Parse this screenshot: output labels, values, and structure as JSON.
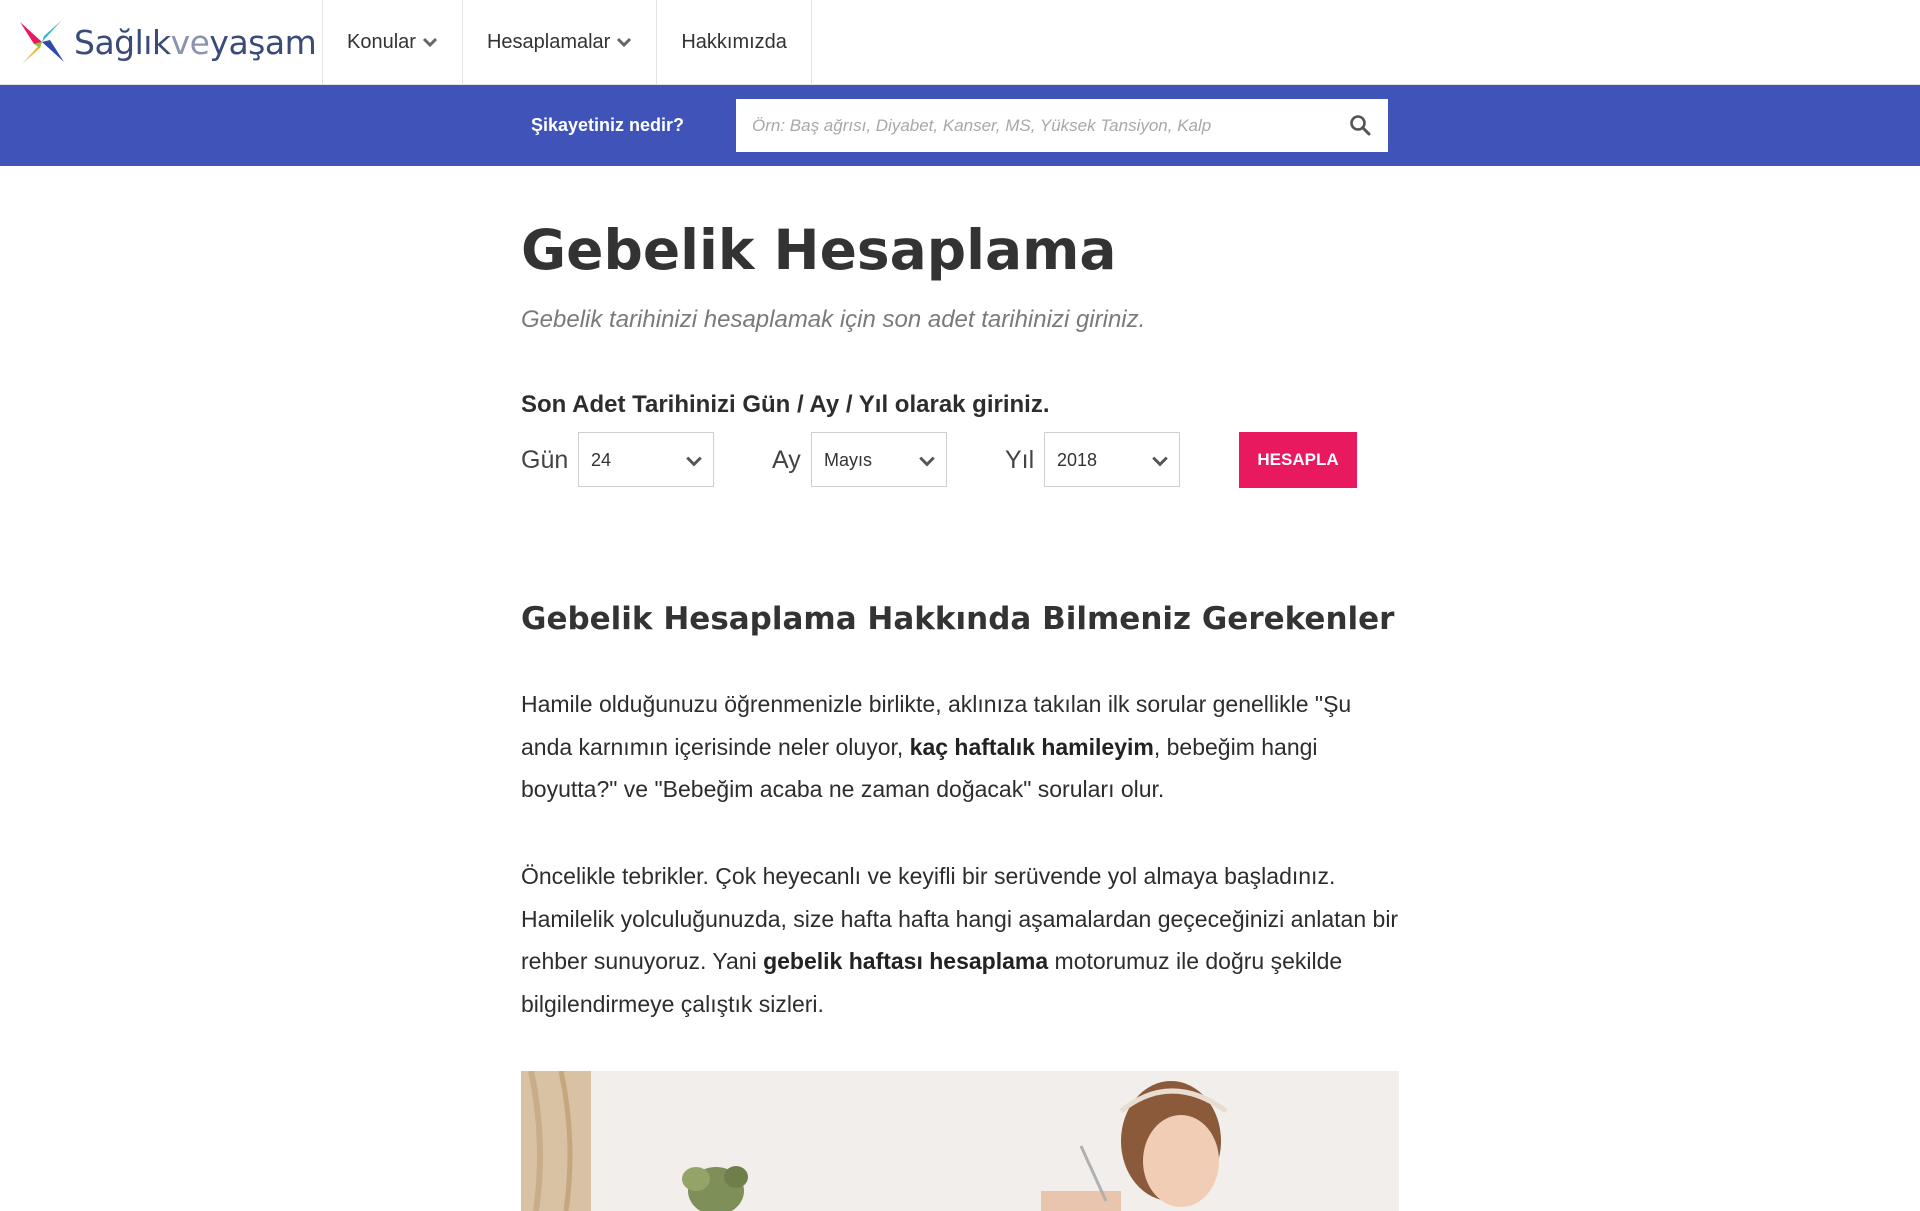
{
  "brand": {
    "logo_part1": "Sağlık",
    "logo_part2": "ve",
    "logo_part3": "yaşam"
  },
  "nav": {
    "items": [
      {
        "label": "Konular",
        "has_dropdown": true
      },
      {
        "label": "Hesaplamalar",
        "has_dropdown": true
      },
      {
        "label": "Hakkımızda",
        "has_dropdown": false
      }
    ]
  },
  "search": {
    "label": "Şikayetiniz nedir?",
    "placeholder": "Örn: Baş ağrısı, Diyabet, Kanser, MS, Yüksek Tansiyon, Kalp",
    "value": "",
    "icon": "search-icon"
  },
  "page": {
    "title": "Gebelik Hesaplama",
    "subtitle": "Gebelik tarihinizi hesaplamak için son adet tarihinizi giriniz."
  },
  "form": {
    "instruction": "Son Adet Tarihinizi Gün / Ay / Yıl olarak giriniz.",
    "day_label": "Gün",
    "day_value": "24",
    "month_label": "Ay",
    "month_value": "Mayıs",
    "year_label": "Yıl",
    "year_value": "2018",
    "submit_label": "HESAPLA"
  },
  "article": {
    "heading": "Gebelik Hesaplama Hakkında Bilmeniz Gerekenler",
    "p1_a": "Hamile olduğunuzu öğrenmenizle birlikte, aklınıza takılan ilk sorular genellikle \"Şu anda karnımın içerisinde neler oluyor, ",
    "p1_b": "kaç haftalık hamileyim",
    "p1_c": ", bebeğim hangi boyutta?\" ve \"Bebeğim acaba ne zaman doğacak\" soruları olur.",
    "p2_a": "Öncelikle tebrikler. Çok heyecanlı ve keyifli bir serüvende yol almaya başladınız. Hamilelik yolculuğunuzda, size hafta hafta hangi aşamalardan geçeceğinizi anlatan bir rehber sunuyoruz. Yani ",
    "p2_b": "gebelik haftası hesaplama",
    "p2_c": " motorumuz ile doğru şekilde bilgilendirmeye çalıştık sizleri."
  },
  "colors": {
    "brand_blue": "#3f53b9",
    "accent_pink": "#e8195f"
  }
}
